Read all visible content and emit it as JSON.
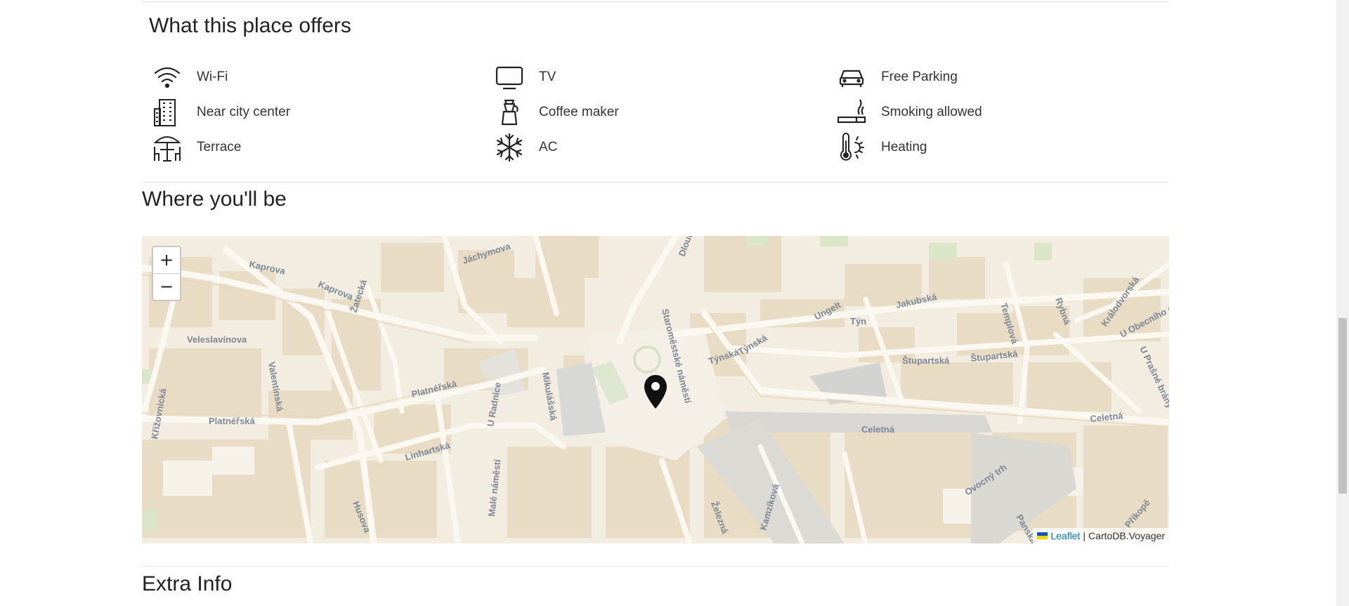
{
  "offers": {
    "title": "What this place offers",
    "amenities": [
      {
        "label": "Wi-Fi",
        "icon": "wifi-icon"
      },
      {
        "label": "TV",
        "icon": "tv-icon"
      },
      {
        "label": "Free Parking",
        "icon": "car-icon"
      },
      {
        "label": "Near city center",
        "icon": "building-icon"
      },
      {
        "label": "Coffee maker",
        "icon": "coffee-maker-icon"
      },
      {
        "label": "Smoking allowed",
        "icon": "cigarette-icon"
      },
      {
        "label": "Terrace",
        "icon": "terrace-icon"
      },
      {
        "label": "AC",
        "icon": "snowflake-icon"
      },
      {
        "label": "Heating",
        "icon": "thermometer-icon"
      }
    ]
  },
  "location": {
    "title": "Where you'll be",
    "map": {
      "zoom_in_label": "+",
      "zoom_out_label": "−",
      "attribution_link": "Leaflet",
      "attribution_separator": "|",
      "attribution_text": "CartoDB.Voyager",
      "streets": [
        "Kaprova",
        "Kaprova",
        "Žatecká",
        "Jáchymova",
        "Dlouhá",
        "Valentinská",
        "Veleslavínova",
        "Křižovnická",
        "Platnéřská",
        "Platnéřská",
        "U Radnice",
        "Mikulášská",
        "Staroměstské náměstí",
        "Týnská",
        "Týnská",
        "Ungelt",
        "Týn",
        "Jakubská",
        "Templová",
        "Rybná",
        "Králodvorská",
        "U Obecního do",
        "U Prašné brány",
        "Štupartská",
        "Štupartská",
        "Celetná",
        "Celetná",
        "Linhartská",
        "Malé náměstí",
        "Husova",
        "Železná",
        "Kamzíková",
        "Ovocný trh",
        "Panská",
        "Na Příkopě"
      ]
    }
  },
  "extra": {
    "title": "Extra Info"
  }
}
